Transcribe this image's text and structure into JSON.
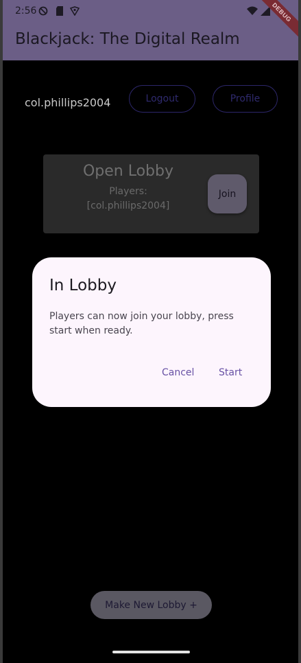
{
  "status_bar": {
    "time": "2:56",
    "icons": [
      "block-icon",
      "sd-card-icon",
      "vpn-shield-icon",
      "wifi-icon",
      "signal-icon"
    ]
  },
  "app_bar": {
    "title": "Blackjack: The Digital Realm",
    "debug_banner": "DEBUG"
  },
  "user_row": {
    "username": "col.phillips2004",
    "logout_label": "Logout",
    "profile_label": "Profile"
  },
  "lobby_card": {
    "title": "Open Lobby",
    "players_label": "Players:",
    "players_value": "[col.phillips2004]",
    "join_label": "Join"
  },
  "dialog": {
    "title": "In Lobby",
    "message": "Players can now join your lobby, press start when ready.",
    "cancel_label": "Cancel",
    "start_label": "Start"
  },
  "footer": {
    "new_lobby_label": "Make New Lobby +"
  },
  "colors": {
    "app_bar": "#6b5e86",
    "background": "#000000",
    "dialog": "#fdf5fd",
    "dialog_action": "#6750a4"
  }
}
